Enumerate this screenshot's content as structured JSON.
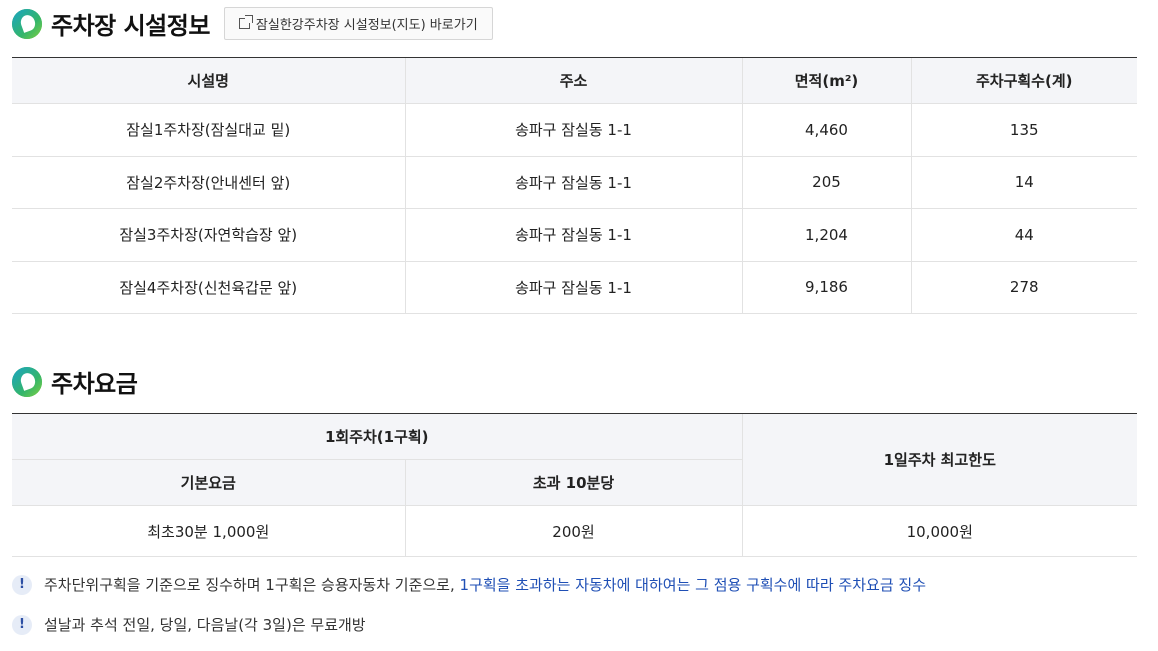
{
  "facility": {
    "title": "주차장 시설정보",
    "map_link": "잠실한강주차장 시설정보(지도) 바로가기",
    "headers": [
      "시설명",
      "주소",
      "면적(m²)",
      "주차구획수(계)"
    ],
    "rows": [
      [
        "잠실1주차장(잠실대교 밑)",
        "송파구 잠실동 1-1",
        "4,460",
        "135"
      ],
      [
        "잠실2주차장(안내센터 앞)",
        "송파구 잠실동 1-1",
        "205",
        "14"
      ],
      [
        "잠실3주차장(자연학습장 앞)",
        "송파구 잠실동 1-1",
        "1,204",
        "44"
      ],
      [
        "잠실4주차장(신천육갑문 앞)",
        "송파구 잠실동 1-1",
        "9,186",
        "278"
      ]
    ]
  },
  "fee": {
    "title": "주차요금",
    "group_header": "1회주차(1구획)",
    "daily_header": "1일주차 최고한도",
    "sub_headers": [
      "기본요금",
      "초과 10분당"
    ],
    "values": [
      "최초30분 1,000원",
      "200원",
      "10,000원"
    ]
  },
  "notes": [
    {
      "text": "주차단위구획을 기준으로 징수하며 1구획은 승용자동차 기준으로, ",
      "highlight": "1구획을 초과하는 자동차에 대하여는 그 점용 구획수에 따라 주차요금 징수"
    },
    {
      "text": "설날과 추석 전일, 당일, 다음날(각 3일)은 무료개방",
      "highlight": ""
    }
  ]
}
